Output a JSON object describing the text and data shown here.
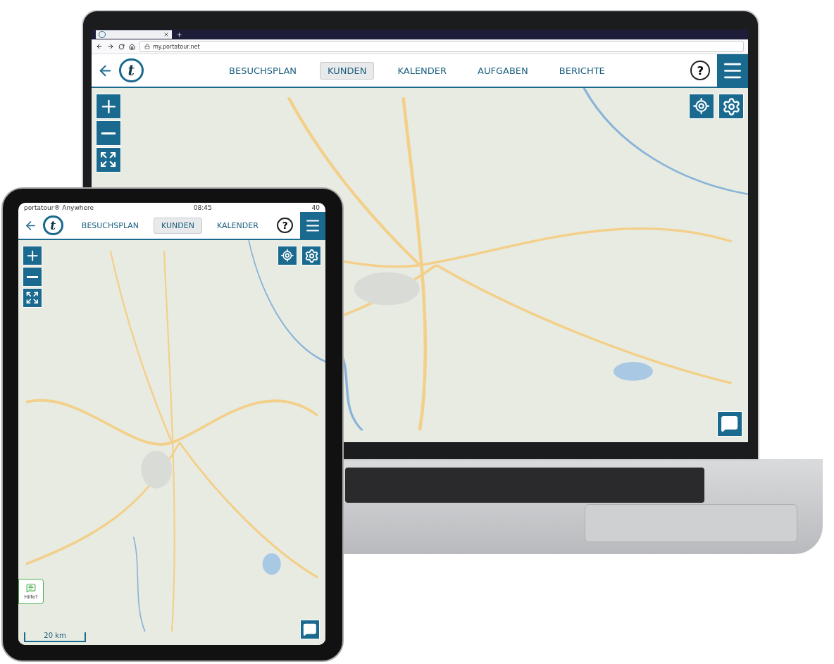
{
  "laptop": {
    "browser": {
      "url": "my.portatour.net"
    },
    "app": {
      "logo_letter": "t",
      "tabs": [
        {
          "label": "BESUCHSPLAN",
          "selected": false
        },
        {
          "label": "KUNDEN",
          "selected": true
        },
        {
          "label": "KALENDER",
          "selected": false
        },
        {
          "label": "AUFGABEN",
          "selected": false
        },
        {
          "label": "BERICHTE",
          "selected": false
        }
      ],
      "help": "?"
    }
  },
  "tablet": {
    "status_bar": {
      "app": "portatour® Anywhere",
      "time": "08:45",
      "battery": "40"
    },
    "app": {
      "logo_letter": "t",
      "tabs": [
        {
          "label": "BESUCHSPLAN",
          "selected": false
        },
        {
          "label": "KUNDEN",
          "selected": true
        },
        {
          "label": "KALENDER",
          "selected": false
        }
      ],
      "help": "?"
    },
    "help_button": "Hilfe?",
    "scale": "20 km"
  }
}
